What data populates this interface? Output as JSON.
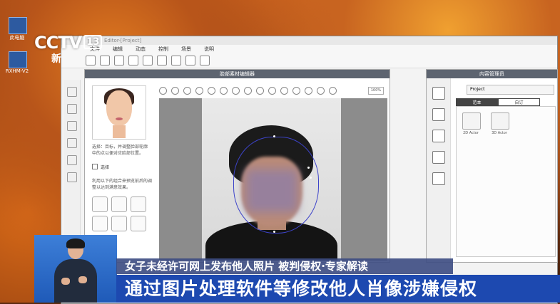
{
  "broadcast": {
    "logo": "CCTV",
    "channel": "13",
    "logo_sub": "新",
    "headline": "女子未经许可网上发布他人照片 被判侵权·专家解读",
    "subtitle": "通过图片处理软件等修改他人肖像涉嫌侵权"
  },
  "desktop": {
    "icons": [
      {
        "name": "folder-icon",
        "label": "此电脑"
      },
      {
        "name": "app-icon",
        "label": "RXHM-V2"
      }
    ]
  },
  "app": {
    "title": "Editor-[Project]",
    "menu": [
      "文件",
      "编辑",
      "动态",
      "控制",
      "场景",
      "说明"
    ],
    "editor": {
      "panel_title": "脸部素材编辑器",
      "hint": "选择：目标，并调整脸部轮廓中的点以便对应脸部位置。",
      "checkbox_label": "选择",
      "hint2": "利用以下的组合来预览前后的调整以达到满意效果。",
      "zoom": "100%"
    },
    "content": {
      "panel_title": "内容管理员",
      "project_dropdown": "Project",
      "tabs": [
        "范本",
        "自订"
      ],
      "cards": [
        {
          "label": "2D Actor"
        },
        {
          "label": "3D Actor"
        }
      ]
    }
  }
}
